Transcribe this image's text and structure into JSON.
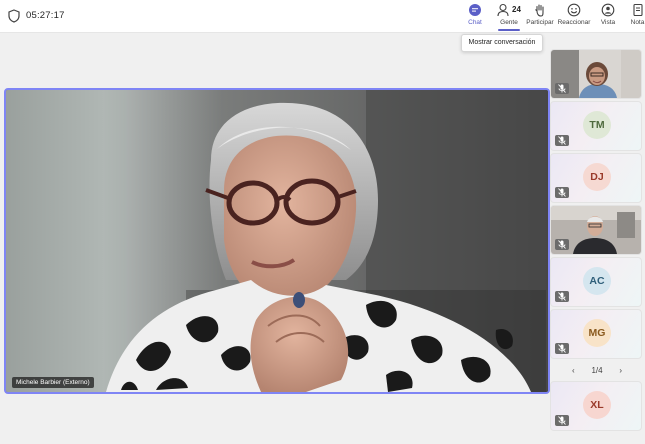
{
  "header": {
    "timer": "05:27:17"
  },
  "toolbar": {
    "chat_label": "Chat",
    "people_label": "Gente",
    "people_count": "24",
    "participate_label": "Participar",
    "react_label": "Reaccionar",
    "view_label": "Vista",
    "notes_label": "Nota"
  },
  "tooltip": {
    "text": "Mostrar conversación"
  },
  "stage": {
    "speaker_name": "Michele Barbier (Externo)"
  },
  "participants": {
    "tiles": [
      {
        "initials": "",
        "type": "video"
      },
      {
        "initials": "TM",
        "type": "avatar"
      },
      {
        "initials": "DJ",
        "type": "avatar"
      },
      {
        "initials": "",
        "type": "video"
      },
      {
        "initials": "AC",
        "type": "avatar"
      },
      {
        "initials": "MG",
        "type": "avatar"
      },
      {
        "initials": "XL",
        "type": "avatar"
      }
    ],
    "pager": "1/4"
  },
  "colors": {
    "accent": "#5b5fc7",
    "active_speaker_border": "#7f85f5"
  }
}
